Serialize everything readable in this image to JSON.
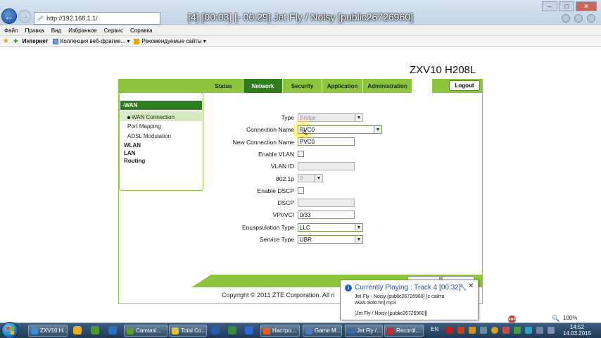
{
  "video_overlay": {
    "title": "[4] [00:03] [- 00:29] Jet Fly / Noisy [public26726960]"
  },
  "browser": {
    "address": "http://192.168.1.1/",
    "menu": [
      "Файл",
      "Правка",
      "Вид",
      "Избранное",
      "Сервис",
      "Справка"
    ],
    "favorites_label": "Интернет",
    "favorites": [
      {
        "label": "Коллекция веб-фрагме... ▾",
        "icon": "slice-icon"
      },
      {
        "label": "Рекомендуемые сайты ▾",
        "icon": "bing-icon"
      }
    ],
    "zoom": "100%"
  },
  "router": {
    "model": "ZXV10 H208L",
    "tabs": [
      "Status",
      "Network",
      "Security",
      "Application",
      "Administration"
    ],
    "active_tab": "Network",
    "logout_label": "Logout",
    "sidebar": {
      "section": "-WAN",
      "items": [
        "WAN Connection",
        "Port Mapping",
        "ADSL Modulation"
      ],
      "groups": [
        "WLAN",
        "LAN",
        "Routing"
      ]
    },
    "form": {
      "type_label": "Type",
      "type_value": "Bridge",
      "conn_name_label": "Connection Name",
      "conn_name_value": "PVC0",
      "new_conn_label": "New Connection Name",
      "new_conn_value": "PVC0",
      "enable_vlan_label": "Enable VLAN",
      "vlan_id_label": "VLAN ID",
      "p8021_label": "802.1p",
      "p8021_value": "0",
      "enable_dscp_label": "Enable DSCP",
      "dscp_label": "DSCP",
      "vpivci_label": "VPI/VCI",
      "vpivci_value": "0/33",
      "encap_label": "Encapsulation Type",
      "encap_value": "LLC",
      "service_label": "Service Type",
      "service_value": "UBR"
    },
    "copyright": "Copyright © 2011 ZTE Corporation. All ri"
  },
  "notification": {
    "title": "Currently Playing : Track 4 [00:32]",
    "line1": "Jet Fly - Noisy [public26726960] [c сайта",
    "line2": "www.ololo.fm].mp3",
    "line3": "[Jet Fly / Noisy [public26726960]]"
  },
  "taskbar": {
    "buttons": [
      "ZXV10 H...",
      "Camtasi...",
      "Total Co...",
      "Настро...",
      "Game M...",
      "Jet Fly /...",
      "Recordi..."
    ],
    "lang": "EN",
    "time": "14:52",
    "date": "14.03.2015"
  },
  "colors": {
    "tab_green": "#8cc63e",
    "active_green": "#2e7d1e",
    "taskbar": "#1f3a56"
  }
}
